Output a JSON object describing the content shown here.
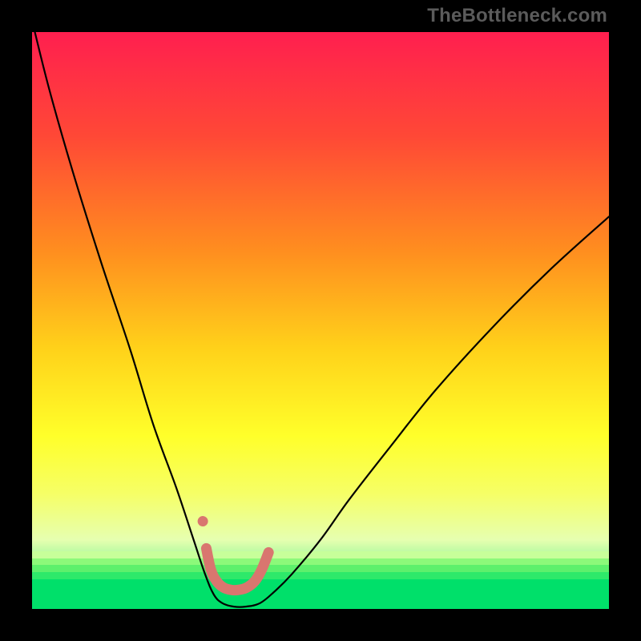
{
  "watermark": "TheBottleneck.com",
  "chart_data": {
    "type": "line",
    "title": "",
    "xlabel": "",
    "ylabel": "",
    "xlim": [
      0,
      100
    ],
    "ylim": [
      0,
      100
    ],
    "gradient_stops": [
      {
        "pos": 0,
        "color": "#ff1f4f"
      },
      {
        "pos": 18,
        "color": "#ff4836"
      },
      {
        "pos": 38,
        "color": "#ff8e1f"
      },
      {
        "pos": 55,
        "color": "#ffd21a"
      },
      {
        "pos": 70,
        "color": "#ffff2a"
      },
      {
        "pos": 80,
        "color": "#f6ff66"
      },
      {
        "pos": 88,
        "color": "#e6ffb0"
      },
      {
        "pos": 100,
        "color": "#00e86b"
      }
    ],
    "green_bands": [
      {
        "top_pct": 90.0,
        "height_pct": 1.2,
        "color": "#c7ff9a"
      },
      {
        "top_pct": 91.2,
        "height_pct": 1.2,
        "color": "#8cf97a"
      },
      {
        "top_pct": 92.4,
        "height_pct": 1.2,
        "color": "#5df06c"
      },
      {
        "top_pct": 93.6,
        "height_pct": 1.3,
        "color": "#2ee96a"
      },
      {
        "top_pct": 94.9,
        "height_pct": 5.1,
        "color": "#00e06a"
      }
    ],
    "series": [
      {
        "name": "bottleneck-curve",
        "stroke": "#000000",
        "stroke_width": 2.2,
        "x": [
          0,
          3,
          7,
          12,
          17,
          21,
          25,
          28,
          30,
          31.5,
          33,
          35,
          37,
          39.5,
          42,
          45,
          50,
          55,
          62,
          70,
          80,
          90,
          100
        ],
        "y": [
          102,
          90,
          76,
          60,
          45,
          32,
          21,
          12,
          6,
          2.5,
          1,
          0.4,
          0.4,
          1,
          3,
          6,
          12,
          19,
          28,
          38,
          49,
          59,
          68
        ]
      }
    ],
    "threshold_marker": {
      "stroke": "#d9766f",
      "stroke_width": 13,
      "linecap": "round",
      "points_xy": [
        [
          30.2,
          10.5
        ],
        [
          31.0,
          6.8
        ],
        [
          32.0,
          4.8
        ],
        [
          33.2,
          3.7
        ],
        [
          34.5,
          3.3
        ],
        [
          35.8,
          3.3
        ],
        [
          37.2,
          3.7
        ],
        [
          38.6,
          4.8
        ],
        [
          39.8,
          6.8
        ],
        [
          41.0,
          9.8
        ]
      ],
      "isolated_dot_xy": [
        29.6,
        15.2
      ]
    }
  }
}
